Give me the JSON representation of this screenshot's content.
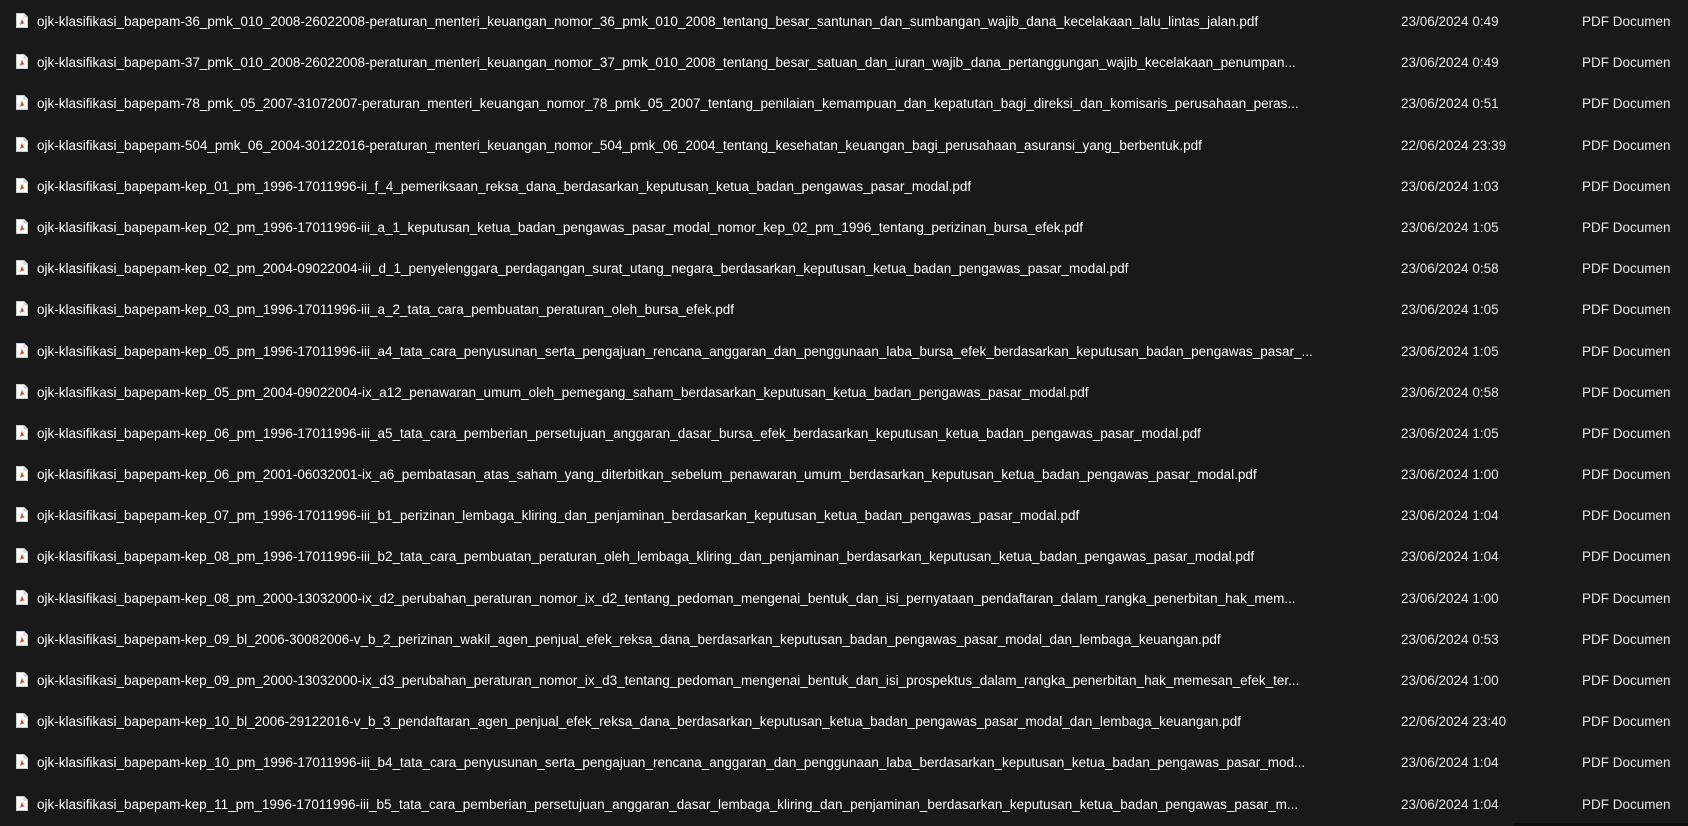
{
  "files": [
    {
      "name": "ojk-klasifikasi_bapepam-36_pmk_010_2008-26022008-peraturan_menteri_keuangan_nomor_36_pmk_010_2008_tentang_besar_santunan_dan_sumbangan_wajib_dana_kecelakaan_lalu_lintas_jalan.pdf",
      "date": "23/06/2024 0:49",
      "type": "PDF Documen"
    },
    {
      "name": "ojk-klasifikasi_bapepam-37_pmk_010_2008-26022008-peraturan_menteri_keuangan_nomor_37_pmk_010_2008_tentang_besar_satuan_dan_iuran_wajib_dana_pertanggungan_wajib_kecelakaan_penumpan...",
      "date": "23/06/2024 0:49",
      "type": "PDF Documen"
    },
    {
      "name": "ojk-klasifikasi_bapepam-78_pmk_05_2007-31072007-peraturan_menteri_keuangan_nomor_78_pmk_05_2007_tentang_penilaian_kemampuan_dan_kepatutan_bagi_direksi_dan_komisaris_perusahaan_peras...",
      "date": "23/06/2024 0:51",
      "type": "PDF Documen"
    },
    {
      "name": "ojk-klasifikasi_bapepam-504_pmk_06_2004-30122016-peraturan_menteri_keuangan_nomor_504_pmk_06_2004_tentang_kesehatan_keuangan_bagi_perusahaan_asuransi_yang_berbentuk.pdf",
      "date": "22/06/2024 23:39",
      "type": "PDF Documen"
    },
    {
      "name": "ojk-klasifikasi_bapepam-kep_01_pm_1996-17011996-ii_f_4_pemeriksaan_reksa_dana_berdasarkan_keputusan_ketua_badan_pengawas_pasar_modal.pdf",
      "date": "23/06/2024 1:03",
      "type": "PDF Documen"
    },
    {
      "name": "ojk-klasifikasi_bapepam-kep_02_pm_1996-17011996-iii_a_1_keputusan_ketua_badan_pengawas_pasar_modal_nomor_kep_02_pm_1996_tentang_perizinan_bursa_efek.pdf",
      "date": "23/06/2024 1:05",
      "type": "PDF Documen"
    },
    {
      "name": "ojk-klasifikasi_bapepam-kep_02_pm_2004-09022004-iii_d_1_penyelenggara_perdagangan_surat_utang_negara_berdasarkan_keputusan_ketua_badan_pengawas_pasar_modal.pdf",
      "date": "23/06/2024 0:58",
      "type": "PDF Documen"
    },
    {
      "name": "ojk-klasifikasi_bapepam-kep_03_pm_1996-17011996-iii_a_2_tata_cara_pembuatan_peraturan_oleh_bursa_efek.pdf",
      "date": "23/06/2024 1:05",
      "type": "PDF Documen"
    },
    {
      "name": "ojk-klasifikasi_bapepam-kep_05_pm_1996-17011996-iii_a4_tata_cara_penyusunan_serta_pengajuan_rencana_anggaran_dan_penggunaan_laba_bursa_efek_berdasarkan_keputusan_badan_pengawas_pasar_...",
      "date": "23/06/2024 1:05",
      "type": "PDF Documen"
    },
    {
      "name": "ojk-klasifikasi_bapepam-kep_05_pm_2004-09022004-ix_a12_penawaran_umum_oleh_pemegang_saham_berdasarkan_keputusan_ketua_badan_pengawas_pasar_modal.pdf",
      "date": "23/06/2024 0:58",
      "type": "PDF Documen"
    },
    {
      "name": "ojk-klasifikasi_bapepam-kep_06_pm_1996-17011996-iii_a5_tata_cara_pemberian_persetujuan_anggaran_dasar_bursa_efek_berdasarkan_keputusan_ketua_badan_pengawas_pasar_modal.pdf",
      "date": "23/06/2024 1:05",
      "type": "PDF Documen"
    },
    {
      "name": "ojk-klasifikasi_bapepam-kep_06_pm_2001-06032001-ix_a6_pembatasan_atas_saham_yang_diterbitkan_sebelum_penawaran_umum_berdasarkan_keputusan_ketua_badan_pengawas_pasar_modal.pdf",
      "date": "23/06/2024 1:00",
      "type": "PDF Documen"
    },
    {
      "name": "ojk-klasifikasi_bapepam-kep_07_pm_1996-17011996-iii_b1_perizinan_lembaga_kliring_dan_penjaminan_berdasarkan_keputusan_ketua_badan_pengawas_pasar_modal.pdf",
      "date": "23/06/2024 1:04",
      "type": "PDF Documen"
    },
    {
      "name": "ojk-klasifikasi_bapepam-kep_08_pm_1996-17011996-iii_b2_tata_cara_pembuatan_peraturan_oleh_lembaga_kliring_dan_penjaminan_berdasarkan_keputusan_ketua_badan_pengawas_pasar_modal.pdf",
      "date": "23/06/2024 1:04",
      "type": "PDF Documen"
    },
    {
      "name": "ojk-klasifikasi_bapepam-kep_08_pm_2000-13032000-ix_d2_perubahan_peraturan_nomor_ix_d2_tentang_pedoman_mengenai_bentuk_dan_isi_pernyataan_pendaftaran_dalam_rangka_penerbitan_hak_mem...",
      "date": "23/06/2024 1:00",
      "type": "PDF Documen"
    },
    {
      "name": "ojk-klasifikasi_bapepam-kep_09_bl_2006-30082006-v_b_2_perizinan_wakil_agen_penjual_efek_reksa_dana_berdasarkan_keputusan_badan_pengawas_pasar_modal_dan_lembaga_keuangan.pdf",
      "date": "23/06/2024 0:53",
      "type": "PDF Documen"
    },
    {
      "name": "ojk-klasifikasi_bapepam-kep_09_pm_2000-13032000-ix_d3_perubahan_peraturan_nomor_ix_d3_tentang_pedoman_mengenai_bentuk_dan_isi_prospektus_dalam_rangka_penerbitan_hak_memesan_efek_ter...",
      "date": "23/06/2024 1:00",
      "type": "PDF Documen"
    },
    {
      "name": "ojk-klasifikasi_bapepam-kep_10_bl_2006-29122016-v_b_3_pendaftaran_agen_penjual_efek_reksa_dana_berdasarkan_keputusan_ketua_badan_pengawas_pasar_modal_dan_lembaga_keuangan.pdf",
      "date": "22/06/2024 23:40",
      "type": "PDF Documen"
    },
    {
      "name": "ojk-klasifikasi_bapepam-kep_10_pm_1996-17011996-iii_b4_tata_cara_penyusunan_serta_pengajuan_rencana_anggaran_dan_penggunaan_laba_berdasarkan_keputusan_ketua_badan_pengawas_pasar_mod...",
      "date": "23/06/2024 1:04",
      "type": "PDF Documen"
    },
    {
      "name": "ojk-klasifikasi_bapepam-kep_11_pm_1996-17011996-iii_b5_tata_cara_pemberian_persetujuan_anggaran_dasar_lembaga_kliring_dan_penjaminan_berdasarkan_keputusan_ketua_badan_pengawas_pasar_m...",
      "date": "23/06/2024 1:04",
      "type": "PDF Documen"
    }
  ],
  "icon": {
    "name": "pdf-file-icon",
    "accent": "#e8401c"
  }
}
